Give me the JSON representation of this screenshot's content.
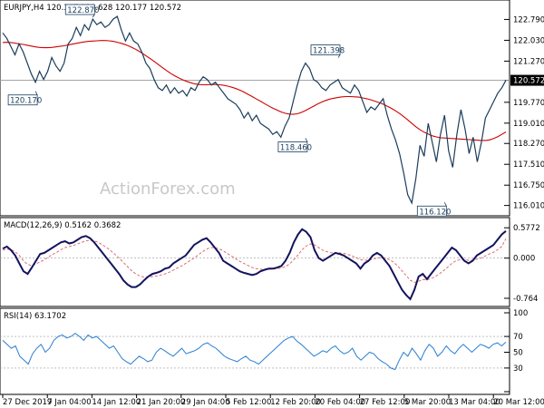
{
  "chart_data": [
    {
      "type": "line",
      "name": "price",
      "title": "EURJPY,H4 120.347 120.628 120.177 120.572",
      "ylim": [
        115.7,
        123.3
      ],
      "y_ticks": [
        "122.790",
        "122.030",
        "121.270",
        "120.572",
        "119.770",
        "119.010",
        "118.270",
        "117.510",
        "116.750",
        "116.010"
      ],
      "x_ticks": [
        "27 Dec 2019",
        "7 Jan 04:00",
        "14 Jan 12:00",
        "21 Jan 20:00",
        "29 Jan 04:00",
        "5 Feb 12:00",
        "12 Feb 20:00",
        "20 Feb 04:00",
        "27 Feb 12:00",
        "5 Mar 20:00",
        "13 Mar 04:00",
        "20 Mar 12:00"
      ],
      "current_price": 120.572,
      "current_price_label": "120.572",
      "annotations": [
        {
          "text": "122.870",
          "x": 22,
          "y": 122.87
        },
        {
          "text": "120.170",
          "x": 8,
          "y": 120.17
        },
        {
          "text": "121.398",
          "x": 82,
          "y": 121.398
        },
        {
          "text": "118.460",
          "x": 74,
          "y": 118.46
        },
        {
          "text": "116.120",
          "x": 108,
          "y": 116.12
        }
      ],
      "watermark": "ActionForex.com",
      "close": [
        122.3,
        122.1,
        121.8,
        121.5,
        121.9,
        121.6,
        121.2,
        120.8,
        120.5,
        120.9,
        120.6,
        120.9,
        121.4,
        121.1,
        120.9,
        121.2,
        121.9,
        122.1,
        122.5,
        122.2,
        122.6,
        122.4,
        122.8,
        122.6,
        122.7,
        122.5,
        122.6,
        122.8,
        122.9,
        122.4,
        122.0,
        122.3,
        122.0,
        121.9,
        121.6,
        121.2,
        121.0,
        120.6,
        120.3,
        120.2,
        120.4,
        120.1,
        120.3,
        120.1,
        120.2,
        120.0,
        120.3,
        120.2,
        120.5,
        120.7,
        120.6,
        120.4,
        120.5,
        120.3,
        120.1,
        119.9,
        119.8,
        119.7,
        119.5,
        119.2,
        119.4,
        119.1,
        119.3,
        119.0,
        118.9,
        118.8,
        118.6,
        118.7,
        118.5,
        118.9,
        119.2,
        119.8,
        120.4,
        120.9,
        121.2,
        121.0,
        120.6,
        120.5,
        120.3,
        120.2,
        120.4,
        120.5,
        120.6,
        120.3,
        120.2,
        120.1,
        120.4,
        120.2,
        119.8,
        119.4,
        119.6,
        119.5,
        119.7,
        119.9,
        119.3,
        118.8,
        118.4,
        117.9,
        117.2,
        116.4,
        116.1,
        117.0,
        118.2,
        117.8,
        119.0,
        118.3,
        117.6,
        118.6,
        119.3,
        118.0,
        117.4,
        118.6,
        119.5,
        118.8,
        117.9,
        118.5,
        117.6,
        118.3,
        119.2,
        119.5,
        119.8,
        120.1,
        120.3,
        120.57
      ],
      "ma": [
        121.95,
        121.96,
        121.95,
        121.93,
        121.9,
        121.88,
        121.85,
        121.82,
        121.79,
        121.77,
        121.76,
        121.76,
        121.77,
        121.79,
        121.81,
        121.83,
        121.86,
        121.89,
        121.92,
        121.95,
        121.97,
        121.99,
        122.0,
        122.01,
        122.02,
        122.02,
        122.01,
        121.99,
        121.96,
        121.92,
        121.87,
        121.81,
        121.74,
        121.66,
        121.57,
        121.47,
        121.37,
        121.26,
        121.15,
        121.04,
        120.93,
        120.83,
        120.74,
        120.66,
        120.59,
        120.53,
        120.48,
        120.44,
        120.42,
        120.41,
        120.41,
        120.42,
        120.42,
        120.41,
        120.39,
        120.36,
        120.32,
        120.27,
        120.21,
        120.14,
        120.06,
        119.98,
        119.89,
        119.81,
        119.72,
        119.64,
        119.56,
        119.49,
        119.42,
        119.37,
        119.34,
        119.33,
        119.35,
        119.4,
        119.47,
        119.55,
        119.63,
        119.71,
        119.78,
        119.84,
        119.89,
        119.92,
        119.95,
        119.97,
        119.98,
        119.98,
        119.97,
        119.96,
        119.93,
        119.9,
        119.86,
        119.81,
        119.76,
        119.7,
        119.63,
        119.55,
        119.46,
        119.36,
        119.25,
        119.13,
        119.0,
        118.88,
        118.77,
        118.68,
        118.61,
        118.55,
        118.51,
        118.48,
        118.47,
        118.46,
        118.45,
        118.44,
        118.43,
        118.42,
        118.41,
        118.4,
        118.39,
        118.38,
        118.38,
        118.4,
        118.45,
        118.52,
        118.6,
        118.69
      ]
    },
    {
      "type": "line",
      "name": "macd",
      "title": "MACD(12,26,9) 0.5162 0.3682",
      "ylim": [
        -0.85,
        0.65
      ],
      "y_ticks": [
        "0.5772",
        "0.000",
        "-0.764"
      ],
      "macd": [
        0.18,
        0.22,
        0.15,
        0.05,
        -0.1,
        -0.25,
        -0.3,
        -0.18,
        -0.05,
        0.08,
        0.1,
        0.15,
        0.2,
        0.25,
        0.3,
        0.32,
        0.28,
        0.3,
        0.35,
        0.4,
        0.42,
        0.38,
        0.3,
        0.2,
        0.1,
        0.0,
        -0.1,
        -0.2,
        -0.3,
        -0.42,
        -0.5,
        -0.55,
        -0.55,
        -0.5,
        -0.42,
        -0.35,
        -0.3,
        -0.28,
        -0.25,
        -0.2,
        -0.18,
        -0.1,
        -0.05,
        0.0,
        0.05,
        0.15,
        0.25,
        0.3,
        0.35,
        0.38,
        0.3,
        0.2,
        0.1,
        -0.05,
        -0.1,
        -0.15,
        -0.2,
        -0.25,
        -0.28,
        -0.3,
        -0.32,
        -0.3,
        -0.25,
        -0.22,
        -0.2,
        -0.2,
        -0.18,
        -0.15,
        -0.05,
        0.1,
        0.3,
        0.45,
        0.55,
        0.5,
        0.4,
        0.15,
        0.0,
        -0.05,
        0.0,
        0.05,
        0.1,
        0.08,
        0.05,
        0.0,
        -0.05,
        -0.1,
        -0.2,
        -0.1,
        -0.05,
        0.05,
        0.1,
        0.05,
        -0.05,
        -0.15,
        -0.3,
        -0.45,
        -0.6,
        -0.7,
        -0.78,
        -0.6,
        -0.35,
        -0.3,
        -0.4,
        -0.3,
        -0.2,
        -0.1,
        0.0,
        0.1,
        0.2,
        0.15,
        0.05,
        -0.05,
        -0.1,
        -0.05,
        0.05,
        0.1,
        0.15,
        0.2,
        0.25,
        0.35,
        0.45,
        0.5162
      ],
      "signal": [
        0.15,
        0.17,
        0.16,
        0.12,
        0.05,
        -0.05,
        -0.12,
        -0.14,
        -0.11,
        -0.07,
        -0.03,
        0.02,
        0.07,
        0.11,
        0.16,
        0.2,
        0.22,
        0.24,
        0.27,
        0.3,
        0.33,
        0.34,
        0.33,
        0.3,
        0.25,
        0.2,
        0.14,
        0.07,
        0.0,
        -0.08,
        -0.16,
        -0.24,
        -0.3,
        -0.34,
        -0.36,
        -0.36,
        -0.35,
        -0.34,
        -0.32,
        -0.3,
        -0.27,
        -0.23,
        -0.19,
        -0.15,
        -0.1,
        -0.05,
        0.0,
        0.06,
        0.12,
        0.17,
        0.2,
        0.2,
        0.18,
        0.14,
        0.09,
        0.04,
        -0.01,
        -0.06,
        -0.1,
        -0.14,
        -0.18,
        -0.2,
        -0.21,
        -0.22,
        -0.21,
        -0.21,
        -0.2,
        -0.19,
        -0.16,
        -0.11,
        -0.03,
        0.06,
        0.16,
        0.23,
        0.27,
        0.25,
        0.2,
        0.15,
        0.12,
        0.1,
        0.1,
        0.1,
        0.09,
        0.07,
        0.04,
        0.01,
        -0.03,
        -0.04,
        -0.04,
        -0.02,
        0.0,
        0.01,
        0.0,
        -0.03,
        -0.08,
        -0.15,
        -0.24,
        -0.33,
        -0.42,
        -0.46,
        -0.44,
        -0.41,
        -0.41,
        -0.39,
        -0.35,
        -0.3,
        -0.24,
        -0.17,
        -0.1,
        -0.05,
        -0.03,
        -0.03,
        -0.04,
        -0.04,
        -0.02,
        0.0,
        0.04,
        0.08,
        0.11,
        0.16,
        0.22,
        0.3682
      ]
    },
    {
      "type": "line",
      "name": "rsi",
      "title": "RSI(14) 63.1702",
      "ylim": [
        0,
        100
      ],
      "y_ticks": [
        "100",
        "70",
        "50",
        "30",
        "0"
      ],
      "rsi": [
        65,
        60,
        55,
        58,
        45,
        40,
        35,
        48,
        55,
        60,
        50,
        55,
        65,
        70,
        72,
        68,
        70,
        74,
        70,
        65,
        72,
        68,
        70,
        65,
        60,
        55,
        58,
        50,
        42,
        38,
        35,
        40,
        45,
        42,
        38,
        40,
        50,
        55,
        52,
        48,
        45,
        50,
        55,
        48,
        50,
        52,
        55,
        60,
        62,
        58,
        55,
        50,
        45,
        42,
        40,
        38,
        42,
        45,
        40,
        38,
        35,
        40,
        45,
        50,
        55,
        60,
        65,
        68,
        70,
        64,
        60,
        55,
        50,
        45,
        48,
        52,
        50,
        55,
        58,
        52,
        48,
        50,
        55,
        45,
        40,
        45,
        50,
        48,
        42,
        38,
        35,
        30,
        28,
        40,
        50,
        45,
        55,
        48,
        40,
        52,
        60,
        55,
        45,
        50,
        58,
        52,
        48,
        55,
        60,
        55,
        50,
        55,
        60,
        58,
        55,
        60,
        62,
        58,
        63
      ],
      "rsi_final": 63.1702
    }
  ]
}
